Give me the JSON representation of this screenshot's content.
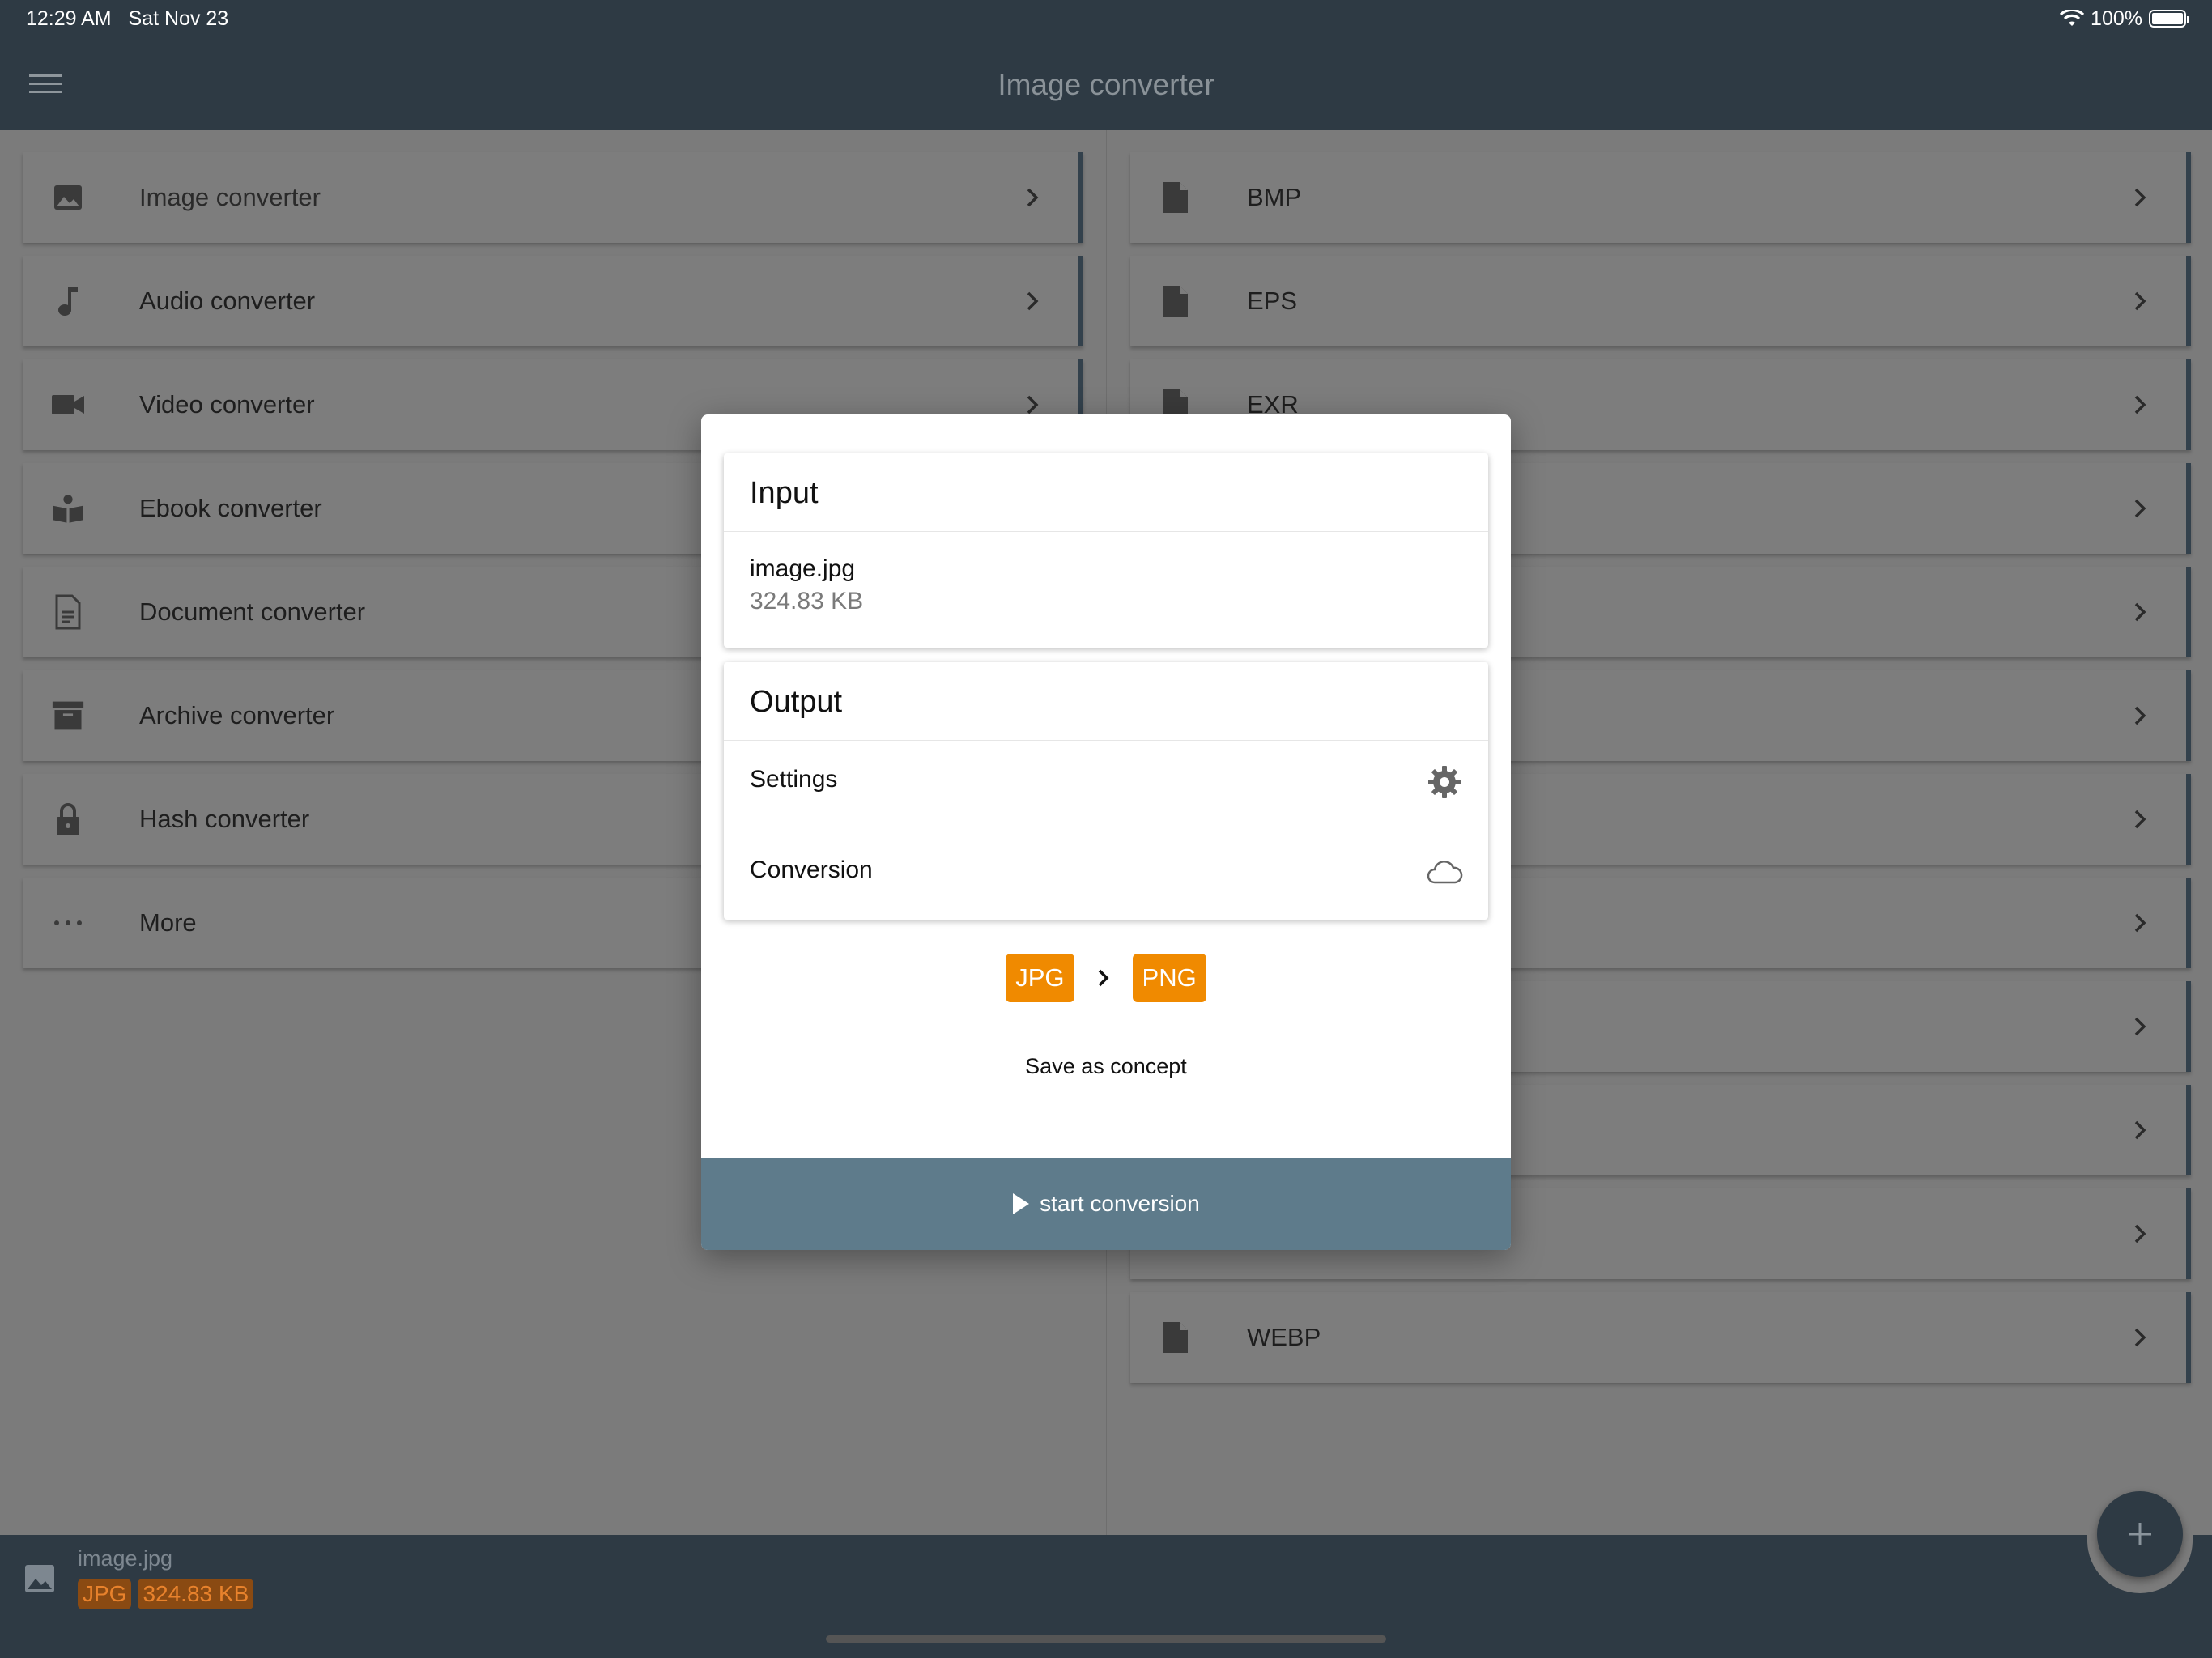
{
  "status_bar": {
    "time": "12:29 AM",
    "date": "Sat Nov 23",
    "battery": "100%"
  },
  "header": {
    "title": "Image converter",
    "menu_icon": "hamburger-icon"
  },
  "left_menu": [
    {
      "label": "Image converter",
      "icon": "image-icon"
    },
    {
      "label": "Audio converter",
      "icon": "music-note-icon"
    },
    {
      "label": "Video converter",
      "icon": "video-camera-icon"
    },
    {
      "label": "Ebook converter",
      "icon": "book-reader-icon"
    },
    {
      "label": "Document converter",
      "icon": "document-icon"
    },
    {
      "label": "Archive converter",
      "icon": "archive-box-icon"
    },
    {
      "label": "Hash converter",
      "icon": "lock-icon"
    },
    {
      "label": "More",
      "icon": "more-dots-icon"
    }
  ],
  "format_list": [
    {
      "label": "BMP"
    },
    {
      "label": "EPS"
    },
    {
      "label": "EXR"
    },
    {
      "label": ""
    },
    {
      "label": ""
    },
    {
      "label": ""
    },
    {
      "label": ""
    },
    {
      "label": ""
    },
    {
      "label": ""
    },
    {
      "label": ""
    },
    {
      "label": ""
    },
    {
      "label": "WEBP"
    }
  ],
  "dialog": {
    "input": {
      "title": "Input",
      "file_name": "image.jpg",
      "file_size": "324.83 KB"
    },
    "output": {
      "title": "Output",
      "settings_label": "Settings",
      "conversion_label": "Conversion"
    },
    "from_format": "JPG",
    "to_format": "PNG",
    "save_concept": "Save as concept",
    "start_label": "start conversion"
  },
  "bottom_bar": {
    "file_name": "image.jpg",
    "format": "JPG",
    "size": "324.83 KB"
  },
  "colors": {
    "header_bg": "#2e3a44",
    "accent_orange": "#f08a00",
    "start_button": "#5e7b8b"
  }
}
